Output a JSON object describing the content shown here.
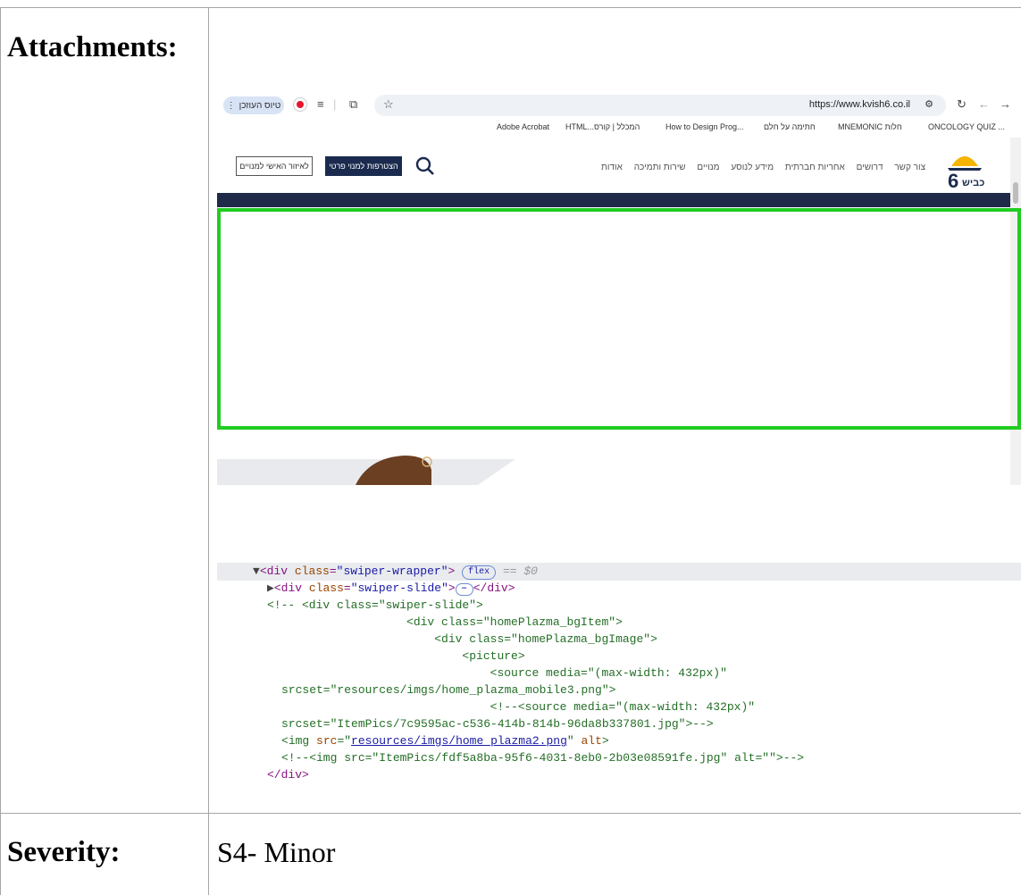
{
  "table": {
    "attachments_label": "Attachments:",
    "severity_label": "Severity:",
    "severity_value": "S4- Minor"
  },
  "browser": {
    "profile_label": "טיוס העוזכן",
    "url": "https://www.kvish6.co.il",
    "bookmarks": [
      "Adobe Acrobat",
      "HTML...המכלל | קורס",
      "How to Design Prog...",
      "חתימה על חלם",
      "MNEMONIC חלות",
      "ONCOLOGY QUIZ ..."
    ]
  },
  "site": {
    "login_button": "לאיזור האישי למנויים",
    "join_button": "הצטרפות למנוי פרטי",
    "nav": [
      "צור קשר",
      "דרושים",
      "אחריות חברתית",
      "מידע לנוסע",
      "מנויים",
      "שירות ותמיכה",
      "אודות"
    ],
    "logo_text": "כביש"
  },
  "code": {
    "l1_tag": "div",
    "l1_attr": "class",
    "l1_val": "\"swiper-wrapper\"",
    "l1_badge": "flex",
    "l1_sel": "== $0",
    "l2_tag": "div",
    "l2_attr": "class",
    "l2_val": "\"swiper-slide\"",
    "l3": "<!-- <div class=\"swiper-slide\">",
    "l4": "                    <div class=\"homePlazma_bgItem\">",
    "l5": "                        <div class=\"homePlazma_bgImage\">",
    "l6": "                            <picture>",
    "l7": "                                <source media=\"(max-width: 432px)\"",
    "l8": "srcset=\"resources/imgs/home_plazma_mobile3.png\">",
    "l9": "                                <!--<source media=\"(max-width: 432px)\"",
    "l10": "srcset=\"ItemPics/7c9595ac-c536-414b-814b-96da8b337801.jpg\">-->",
    "l11_tag": "img",
    "l11_attr": "src",
    "l11_link": "resources/imgs/home_plazma2.png",
    "l11_attr2": "alt",
    "l12": "<!--<img src=\"ItemPics/fdf5a8ba-95f6-4031-8eb0-2b03e08591fe.jpg\" alt=\"\">-->",
    "l13": "</div>"
  },
  "colors": {
    "highlight_border": "#22cc22",
    "site_dark": "#1b2b4f"
  }
}
